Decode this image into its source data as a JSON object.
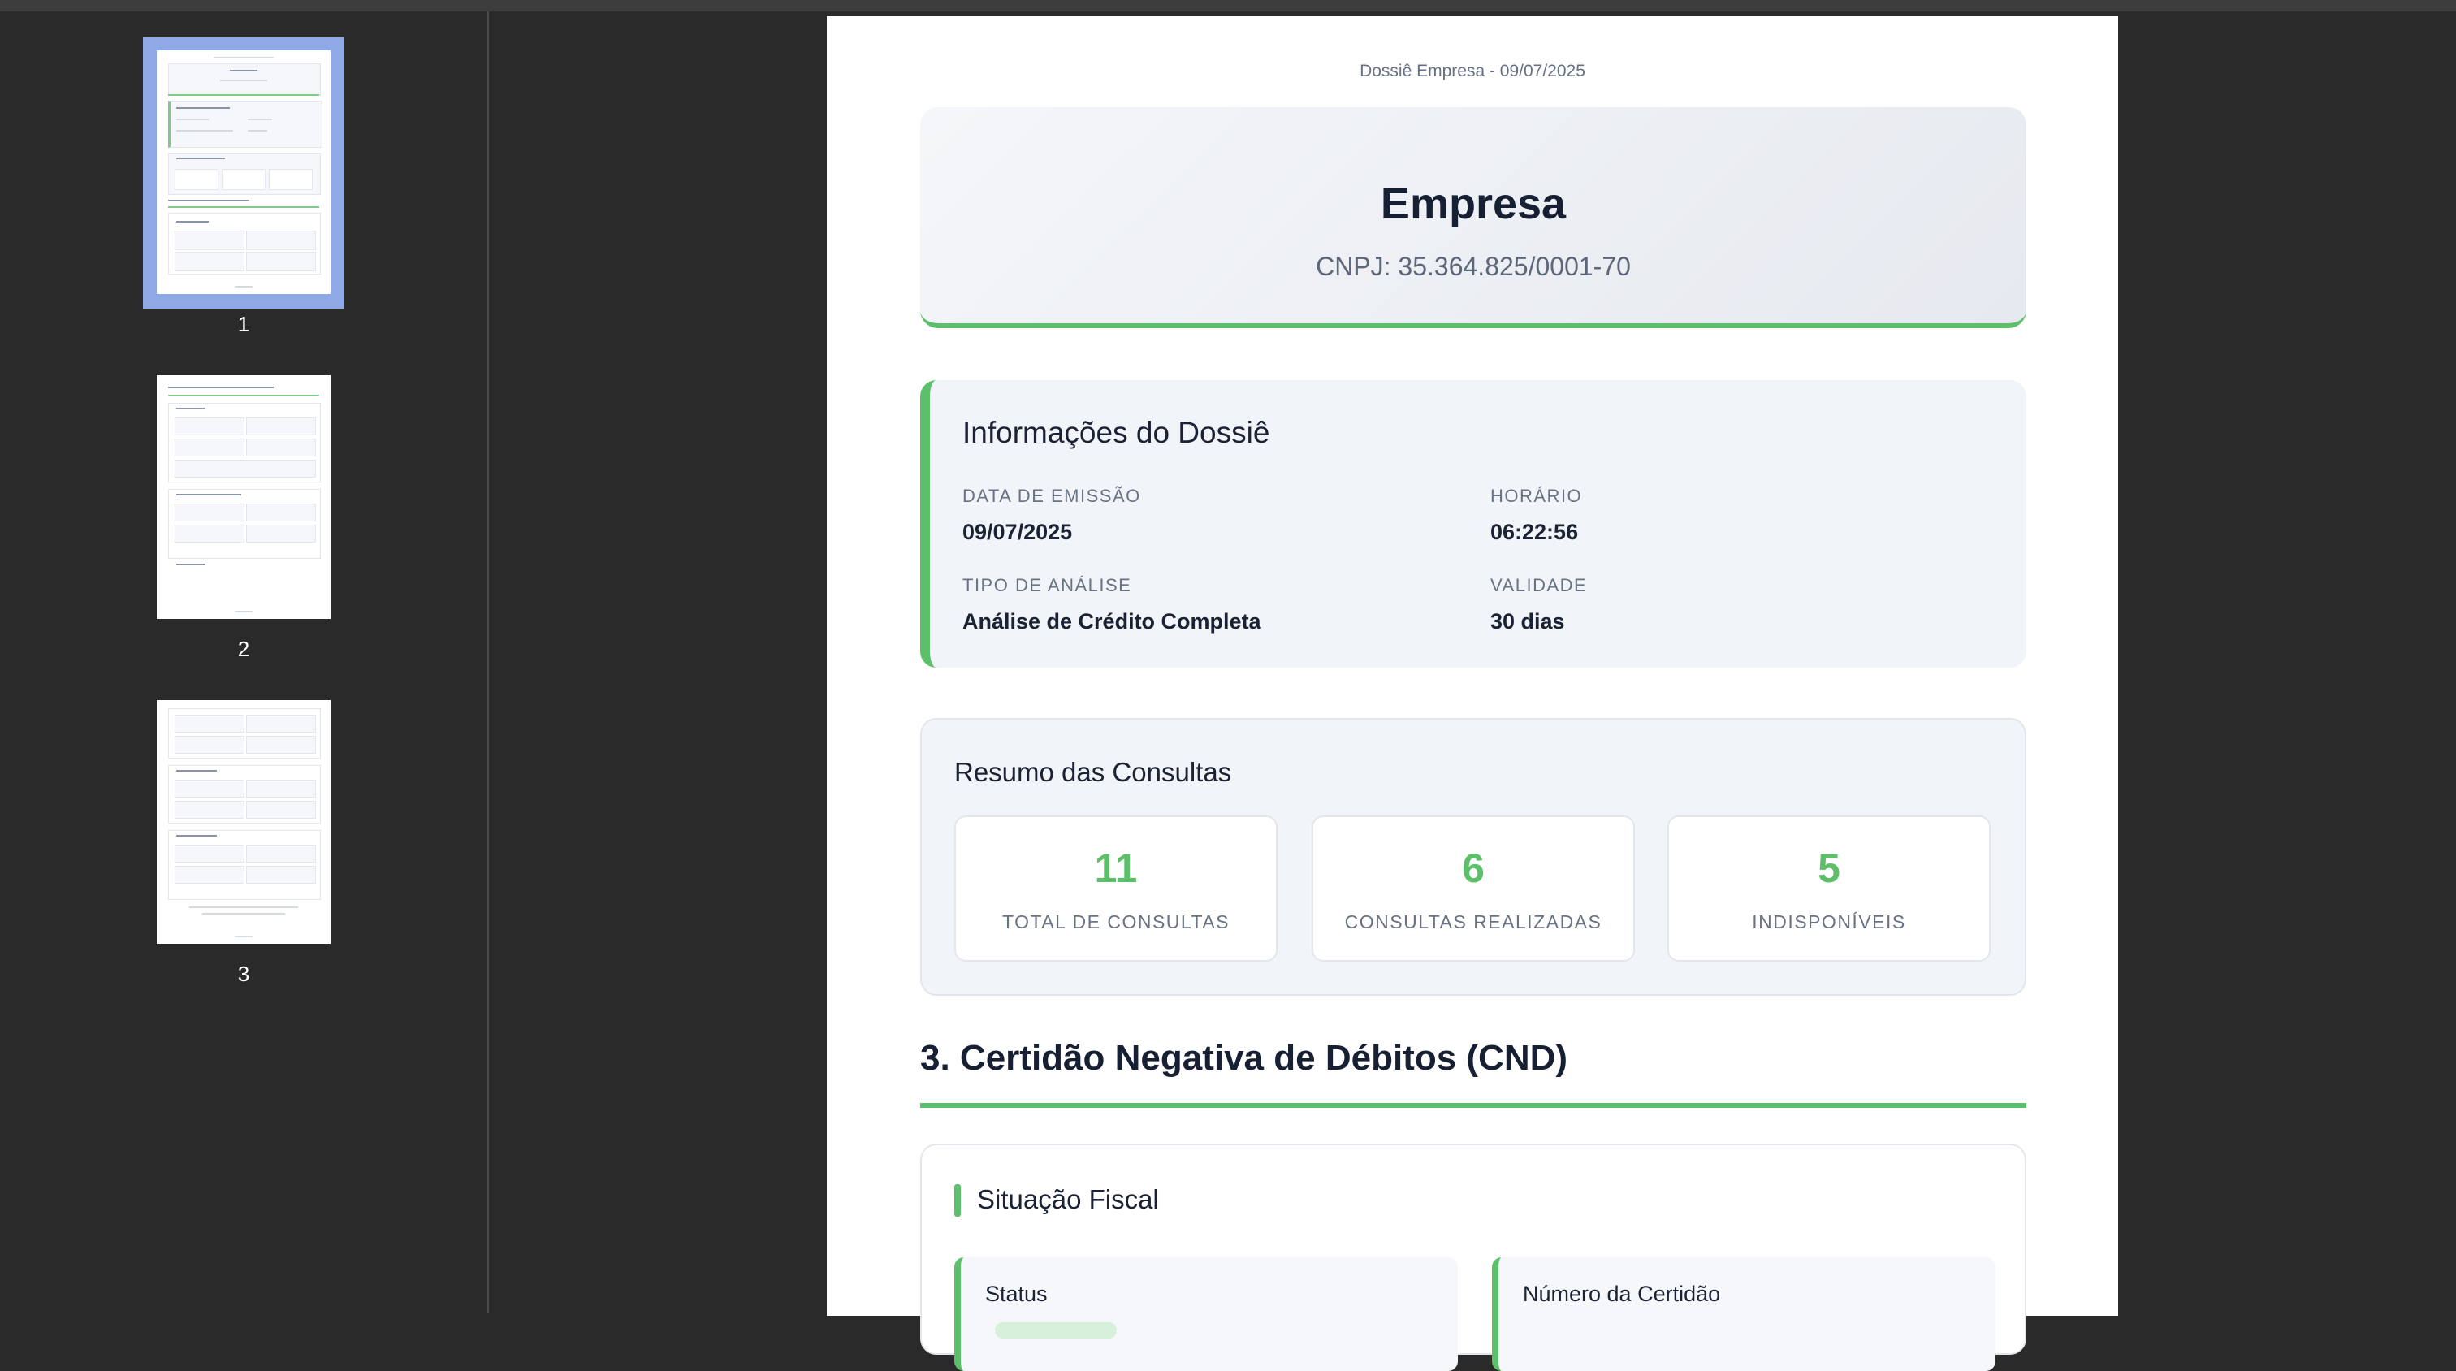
{
  "thumbnails": [
    {
      "page": "1",
      "selected": true
    },
    {
      "page": "2",
      "selected": false
    },
    {
      "page": "3",
      "selected": false
    }
  ],
  "document": {
    "header": "Dossiê Empresa - 09/07/2025",
    "company_name": "Empresa",
    "cnpj": "CNPJ: 35.364.825/0001-70",
    "info": {
      "title": "Informações do Dossiê",
      "fields": [
        {
          "label": "DATA DE EMISSÃO",
          "value": "09/07/2025"
        },
        {
          "label": "HORÁRIO",
          "value": "06:22:56"
        },
        {
          "label": "TIPO DE ANÁLISE",
          "value": "Análise de Crédito Completa"
        },
        {
          "label": "VALIDADE",
          "value": "30 dias"
        }
      ]
    },
    "summary": {
      "title": "Resumo das Consultas",
      "stats": [
        {
          "value": "11",
          "label": "TOTAL DE CONSULTAS"
        },
        {
          "value": "6",
          "label": "CONSULTAS REALIZADAS"
        },
        {
          "value": "5",
          "label": "INDISPONÍVEIS"
        }
      ]
    },
    "section": {
      "title": "3. Certidão Negativa de Débitos (CND)",
      "subsection": "Situação Fiscal",
      "cards": [
        "Status",
        "Número da Certidão"
      ]
    }
  },
  "colors": {
    "accent": "#5cbf6a",
    "viewer_bg": "#2a2a2a",
    "thumb_selection": "#8fa9e6"
  }
}
